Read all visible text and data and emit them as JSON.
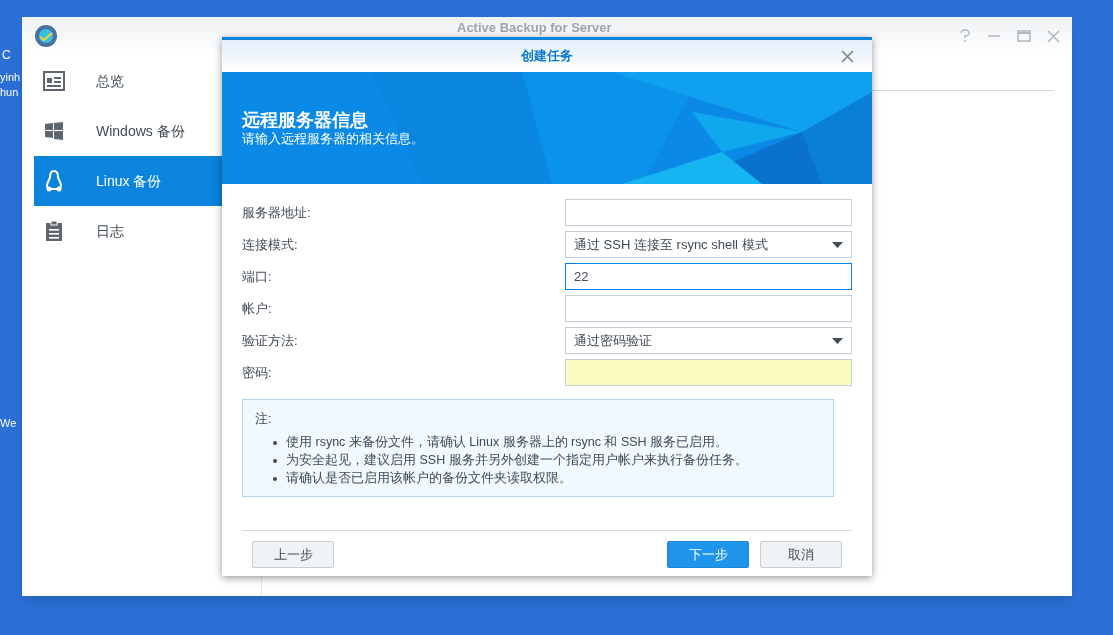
{
  "desktop": {
    "labels": [
      {
        "text": "C"
      },
      {
        "text": "yinh"
      },
      {
        "text": "hun"
      },
      {
        "text": "We"
      }
    ]
  },
  "window": {
    "title": "Active Backup for Server"
  },
  "sidebar": {
    "items": [
      {
        "label": "总览",
        "kind": "overview",
        "selected": false
      },
      {
        "label": "Windows 备份",
        "kind": "windows",
        "selected": false
      },
      {
        "label": "Linux 备份",
        "kind": "linux",
        "selected": true
      },
      {
        "label": "日志",
        "kind": "log",
        "selected": false
      }
    ]
  },
  "dialog": {
    "title": "创建任务",
    "heading": "远程服务器信息",
    "subheading": "请输入远程服务器的相关信息。",
    "fields": [
      {
        "label": "服务器地址:",
        "kind": "text",
        "focused": false,
        "required": false
      },
      {
        "label": "连接模式:",
        "kind": "select",
        "value": "通过 SSH 连接至 rsync shell 模式"
      },
      {
        "label": "端口:",
        "kind": "text",
        "value": "22",
        "focused": true,
        "required": false
      },
      {
        "label": "帐户:",
        "kind": "text",
        "focused": false,
        "required": false
      },
      {
        "label": "验证方法:",
        "kind": "select",
        "value": "通过密码验证"
      },
      {
        "label": "密码:",
        "kind": "password",
        "focused": false,
        "required": true
      }
    ],
    "note": {
      "title": "注:",
      "items": [
        "使用 rsync 来备份文件，请确认 Linux 服务器上的 rsync 和 SSH 服务已启用。",
        "为安全起见，建议启用 SSH 服务并另外创建一个指定用户帐户来执行备份任务。",
        "请确认是否已启用该帐户的备份文件夹读取权限。"
      ]
    },
    "buttons": [
      {
        "label": "上一步",
        "kind": "secondary"
      },
      {
        "label": "下一步",
        "kind": "primary"
      },
      {
        "label": "取消",
        "kind": "secondary"
      }
    ]
  }
}
